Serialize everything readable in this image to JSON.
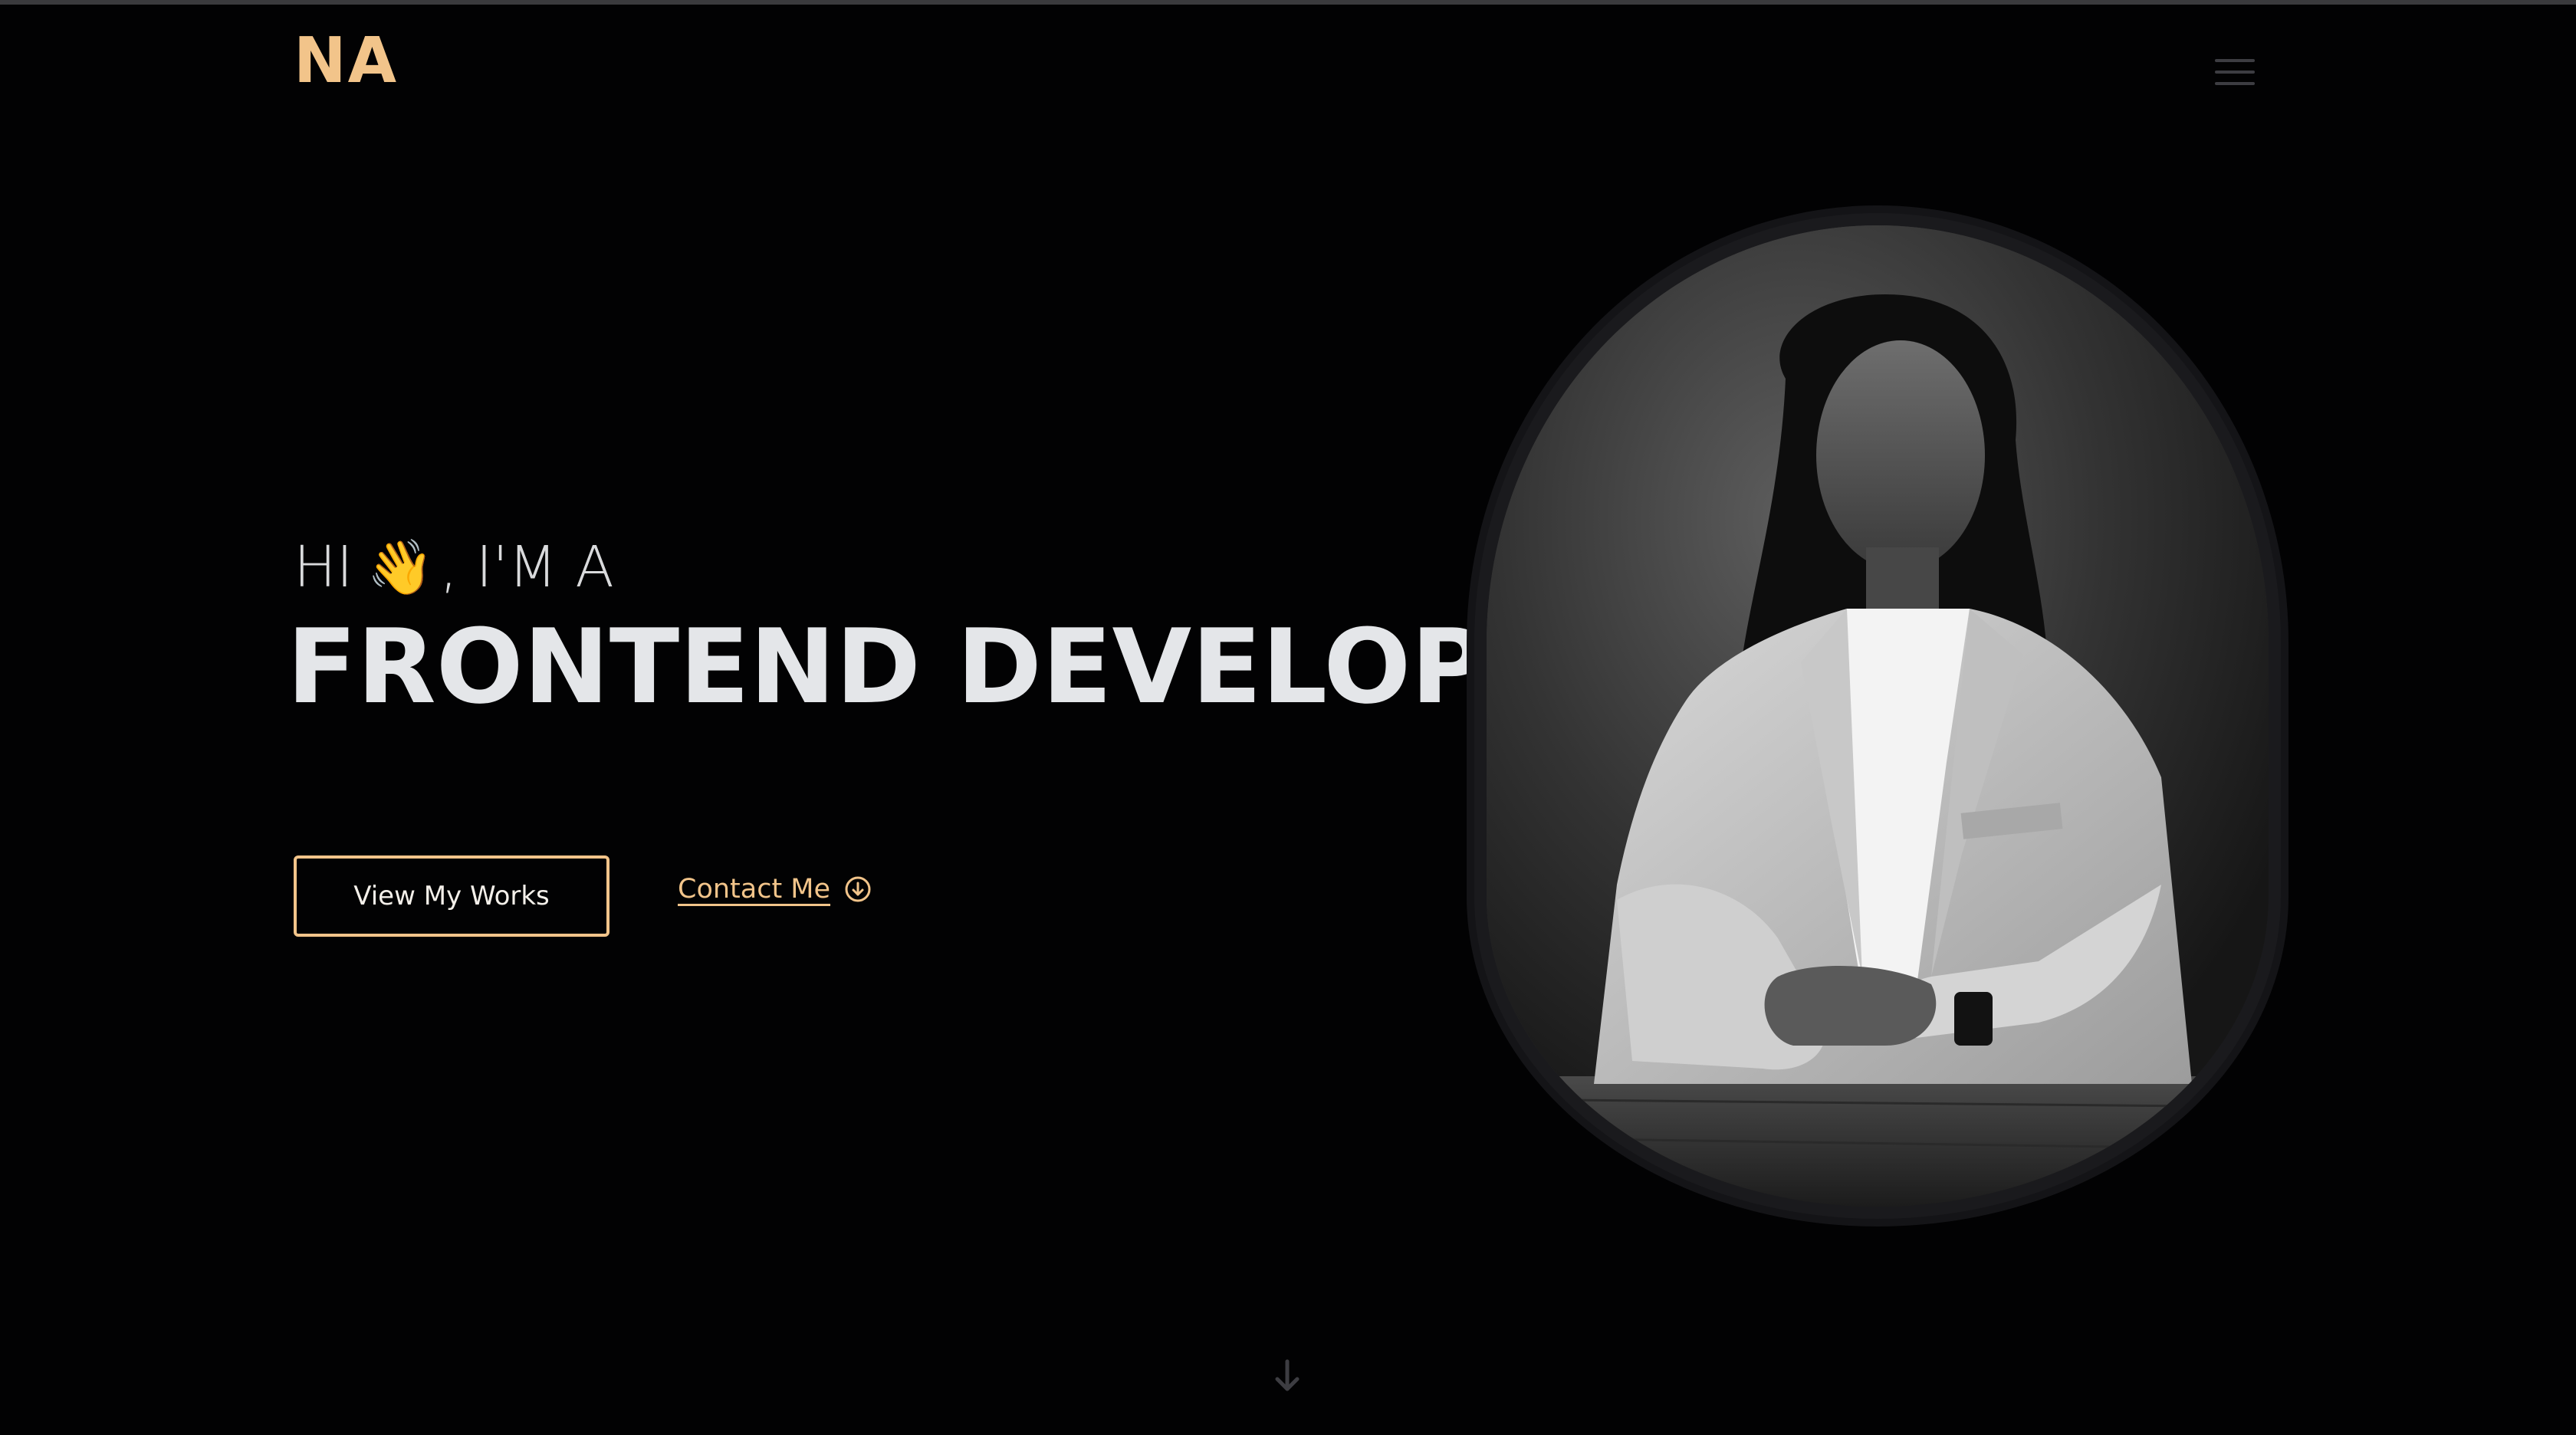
{
  "header": {
    "logo": "NA",
    "menu_icon": "hamburger-menu-icon"
  },
  "hero": {
    "greeting_pre": "HI",
    "greeting_emoji": "👋",
    "greeting_post": ", I'M A",
    "headline": "FRONTEND DEVELOPER",
    "primary_button": "View My Works",
    "contact_link": "Contact Me",
    "contact_icon": "arrow-down-circle-icon",
    "scroll_icon": "arrow-down-icon"
  },
  "colors": {
    "background": "#020203",
    "accent": "#f2c48a",
    "headline": "#e4e6e9",
    "muted": "#3d3d42"
  }
}
